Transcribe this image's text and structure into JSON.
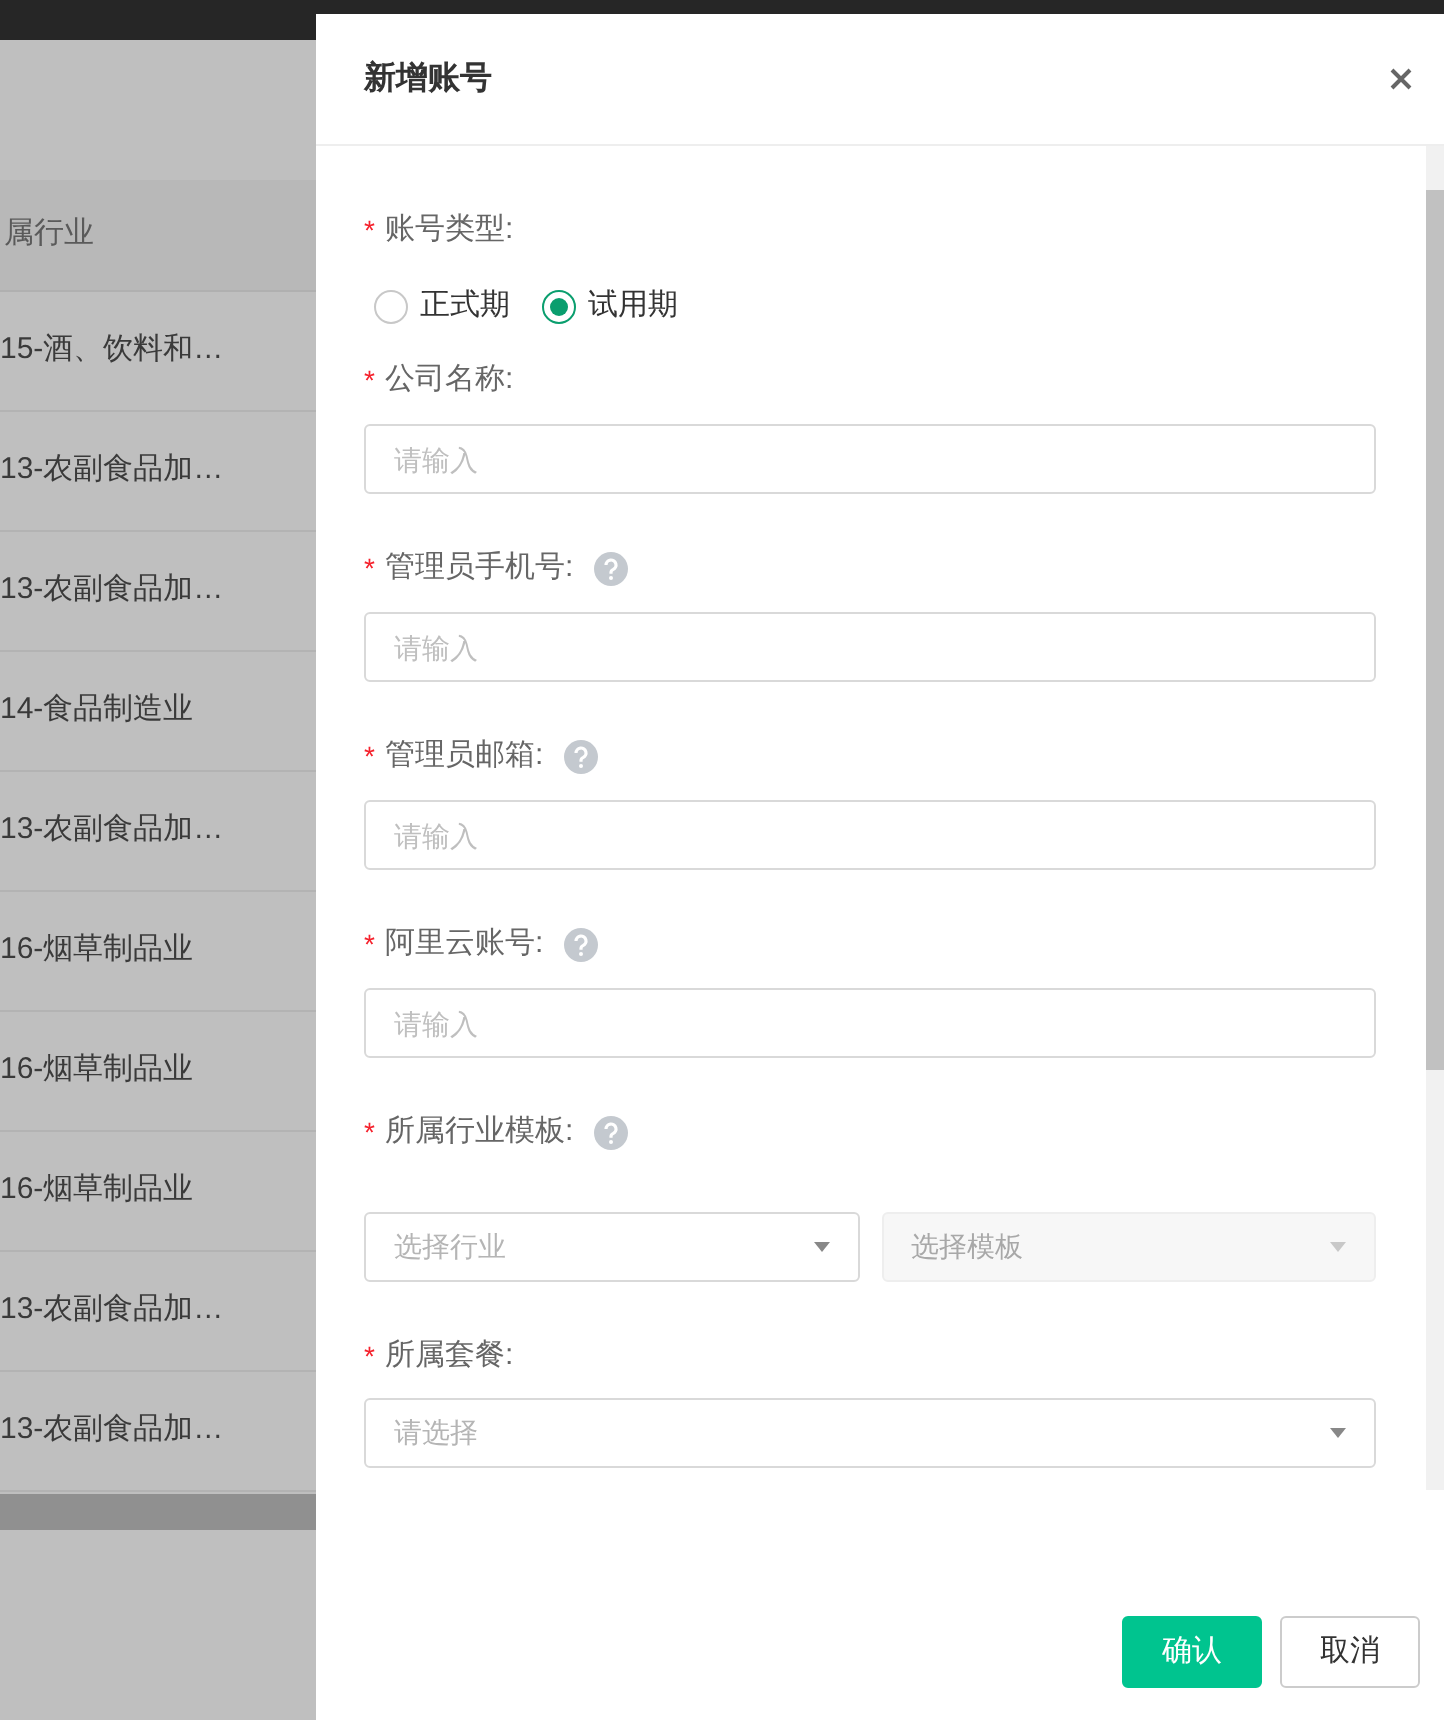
{
  "background_table": {
    "column_header": "属行业",
    "rows": [
      "15-酒、饮料和…",
      "13-农副食品加…",
      "13-农副食品加…",
      "14-食品制造业",
      "13-农副食品加…",
      "16-烟草制品业",
      "16-烟草制品业",
      "16-烟草制品业",
      "13-农副食品加…",
      "13-农副食品加…"
    ]
  },
  "dialog": {
    "title": "新增账号",
    "fields": [
      {
        "kind": "radio",
        "mark": "*",
        "label": "账号类型:",
        "options": [
          {
            "label": "正式期",
            "selected": false
          },
          {
            "label": "试用期",
            "selected": true
          }
        ]
      },
      {
        "kind": "input",
        "mark": "*",
        "label": "公司名称:",
        "help": false,
        "placeholder": "请输入"
      },
      {
        "kind": "input",
        "mark": "*",
        "label": "管理员手机号:",
        "help": true,
        "placeholder": "请输入"
      },
      {
        "kind": "input",
        "mark": "*",
        "label": "管理员邮箱:",
        "help": true,
        "placeholder": "请输入"
      },
      {
        "kind": "input",
        "mark": "*",
        "label": "阿里云账号:",
        "help": true,
        "placeholder": "请输入"
      },
      {
        "kind": "select_pair",
        "mark": "*",
        "label": "所属行业模板:",
        "help": true,
        "selects": [
          {
            "placeholder": "选择行业",
            "disabled": false
          },
          {
            "placeholder": "选择模板",
            "disabled": true
          }
        ]
      },
      {
        "kind": "select",
        "mark": "*",
        "label": "所属套餐:",
        "help": false,
        "placeholder": "请选择"
      }
    ],
    "buttons": [
      {
        "label": "确认",
        "kind": "primary"
      },
      {
        "label": "取消",
        "kind": "default"
      }
    ]
  }
}
